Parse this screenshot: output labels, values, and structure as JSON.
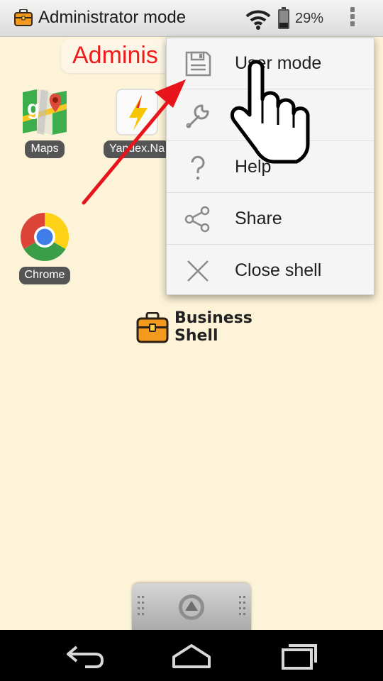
{
  "status_bar": {
    "title": "Administrator mode",
    "battery_percent": "29%",
    "icons": [
      "business-shell-icon",
      "wifi-icon",
      "battery-icon",
      "overflow-menu-icon"
    ]
  },
  "banner": {
    "text": "Adminis"
  },
  "apps": [
    {
      "label": "Maps",
      "icon": "google-maps-icon"
    },
    {
      "label": "Yandex.Na",
      "icon": "yandex-navigator-icon"
    },
    {
      "label": "Chrome",
      "icon": "chrome-icon"
    }
  ],
  "brand": {
    "line1": "Business",
    "line2": "Shell",
    "icon": "briefcase-icon"
  },
  "menu": {
    "items": [
      {
        "label": "User mode",
        "icon": "floppy-disk-icon"
      },
      {
        "label": "",
        "icon": "wrench-icon"
      },
      {
        "label": "Help",
        "icon": "question-mark-icon"
      },
      {
        "label": "Share",
        "icon": "share-icon"
      },
      {
        "label": "Close shell",
        "icon": "close-x-icon"
      }
    ]
  },
  "nav_bar": {
    "icons": [
      "back-icon",
      "home-icon",
      "recents-icon"
    ]
  },
  "colors": {
    "background": "#fdf3d8",
    "banner_text": "#ee1c1c",
    "annotation_arrow": "#e8141b",
    "label_pill": "#555555"
  }
}
